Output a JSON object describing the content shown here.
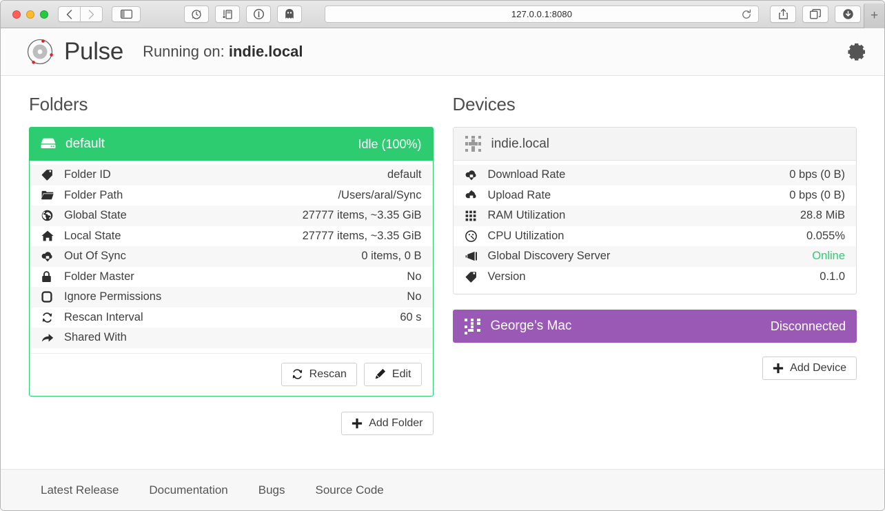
{
  "browser": {
    "url": "127.0.0.1:8080",
    "nav_back_icon": "chevron-left-icon",
    "nav_forward_icon": "chevron-right-icon",
    "sidebar_icon": "sidebar-icon",
    "extensions": [
      "adblock-icon",
      "password-manager-icon",
      "info-icon",
      "ghostery-icon"
    ],
    "reload_icon": "reload-icon",
    "share_icon": "share-icon",
    "tabs_icon": "show-tabs-icon",
    "downloads_icon": "downloads-icon",
    "new_tab_label": "+"
  },
  "header": {
    "logo_icon": "pulse-atom-logo",
    "brand": "Pulse",
    "running_prefix": "Running on:",
    "host": "indie.local",
    "settings_icon": "gear-icon"
  },
  "folders": {
    "title": "Folders",
    "card": {
      "icon": "hard-drive-icon",
      "name": "default",
      "status": "Idle (100%)",
      "rows": [
        {
          "icon": "tag-icon",
          "label": "Folder ID",
          "value": "default"
        },
        {
          "icon": "folder-icon",
          "label": "Folder Path",
          "value": "/Users/aral/Sync"
        },
        {
          "icon": "globe-icon",
          "label": "Global State",
          "value": "27777 items, ~3.35 GiB"
        },
        {
          "icon": "home-icon",
          "label": "Local State",
          "value": "27777 items, ~3.35 GiB"
        },
        {
          "icon": "cloud-download-icon",
          "label": "Out Of Sync",
          "value": "0 items, 0 B"
        },
        {
          "icon": "lock-icon",
          "label": "Folder Master",
          "value": "No"
        },
        {
          "icon": "octagon-icon",
          "label": "Ignore Permissions",
          "value": "No"
        },
        {
          "icon": "refresh-icon",
          "label": "Rescan Interval",
          "value": "60 s"
        },
        {
          "icon": "share-arrow-icon",
          "label": "Shared With",
          "value": ""
        }
      ],
      "rescan_label": "Rescan",
      "rescan_icon": "refresh-icon",
      "edit_label": "Edit",
      "edit_icon": "pencil-icon"
    },
    "add_label": "Add Folder",
    "add_icon": "plus-icon"
  },
  "devices": {
    "title": "Devices",
    "card": {
      "icon": "device-id-icon",
      "name": "indie.local",
      "rows": [
        {
          "icon": "cloud-download-icon",
          "label": "Download Rate",
          "value": "0 bps (0 B)"
        },
        {
          "icon": "cloud-upload-icon",
          "label": "Upload Rate",
          "value": "0 bps (0 B)"
        },
        {
          "icon": "grid-icon",
          "label": "RAM Utilization",
          "value": "28.8 MiB"
        },
        {
          "icon": "gauge-icon",
          "label": "CPU Utilization",
          "value": "0.055%"
        },
        {
          "icon": "megaphone-icon",
          "label": "Global Discovery Server",
          "value": "Online",
          "state": "online"
        },
        {
          "icon": "tag-icon",
          "label": "Version",
          "value": "0.1.0"
        }
      ]
    },
    "remote": {
      "icon": "device-id-icon",
      "name": "George’s Mac",
      "status": "Disconnected"
    },
    "add_label": "Add Device",
    "add_icon": "plus-icon"
  },
  "footer": {
    "links": [
      "Latest Release",
      "Documentation",
      "Bugs",
      "Source Code"
    ]
  },
  "colors": {
    "green": "#2ecc71",
    "purple": "#9b59b6",
    "online": "#2ecc71"
  }
}
